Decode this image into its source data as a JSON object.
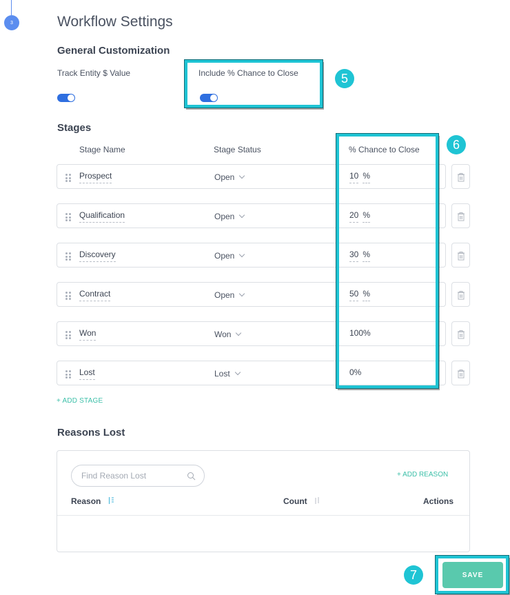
{
  "step": {
    "number": "3"
  },
  "page": {
    "title": "Workflow Settings"
  },
  "general": {
    "title": "General Customization",
    "track_entity_label": "Track Entity $ Value",
    "track_entity_on": true,
    "include_chance_label": "Include % Chance to Close",
    "include_chance_on": true
  },
  "callouts": {
    "five": "5",
    "six": "6",
    "seven": "7"
  },
  "stages": {
    "title": "Stages",
    "headers": {
      "name": "Stage Name",
      "status": "Stage Status",
      "chance": "% Chance to Close"
    },
    "rows": [
      {
        "name": "Prospect",
        "status": "Open",
        "chance": "10",
        "unit": "%"
      },
      {
        "name": "Qualification",
        "status": "Open",
        "chance": "20",
        "unit": "%"
      },
      {
        "name": "Discovery",
        "status": "Open",
        "chance": "30",
        "unit": "%"
      },
      {
        "name": "Contract",
        "status": "Open",
        "chance": "50",
        "unit": "%"
      },
      {
        "name": "Won",
        "status": "Won",
        "chance": "100%",
        "unit": ""
      },
      {
        "name": "Lost",
        "status": "Lost",
        "chance": "0%",
        "unit": ""
      }
    ],
    "add_label": "+ ADD STAGE"
  },
  "reasons": {
    "title": "Reasons Lost",
    "search_placeholder": "Find Reason Lost",
    "add_label": "+ ADD REASON",
    "headers": {
      "reason": "Reason",
      "count": "Count",
      "actions": "Actions"
    }
  },
  "actions": {
    "save_label": "SAVE"
  },
  "colors": {
    "accent_teal": "#1fc4d4",
    "toggle_blue": "#2f6fe0",
    "save_green": "#59c9ad",
    "link_green": "#3bbfa8"
  },
  "icons": [
    "drag-handle-icon",
    "chevron-down-icon",
    "trash-icon",
    "search-icon",
    "sort-icon"
  ]
}
